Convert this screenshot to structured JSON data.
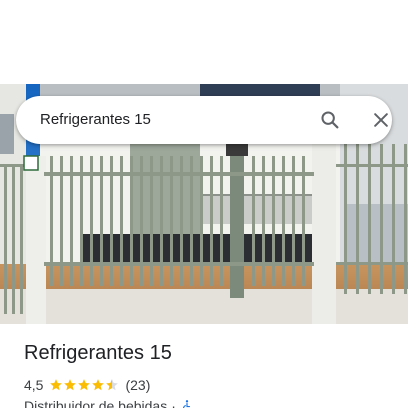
{
  "search": {
    "query": "Refrigerantes 15",
    "search_icon": "search-icon",
    "close_icon": "close-icon"
  },
  "photo": {
    "subject": "place-photo"
  },
  "place": {
    "name": "Refrigerantes 15",
    "rating": "4,5",
    "stars_filled": 4.5,
    "stars_total": 5,
    "review_count": "(23)",
    "category": "Distribuidor de bebidas",
    "separator": "·",
    "accessibility_icon": "wheelchair-icon"
  },
  "colors": {
    "star": "#fbbc04",
    "accessibility": "#1a73e8",
    "text": "#202124",
    "secondary_text": "#3c4043"
  }
}
